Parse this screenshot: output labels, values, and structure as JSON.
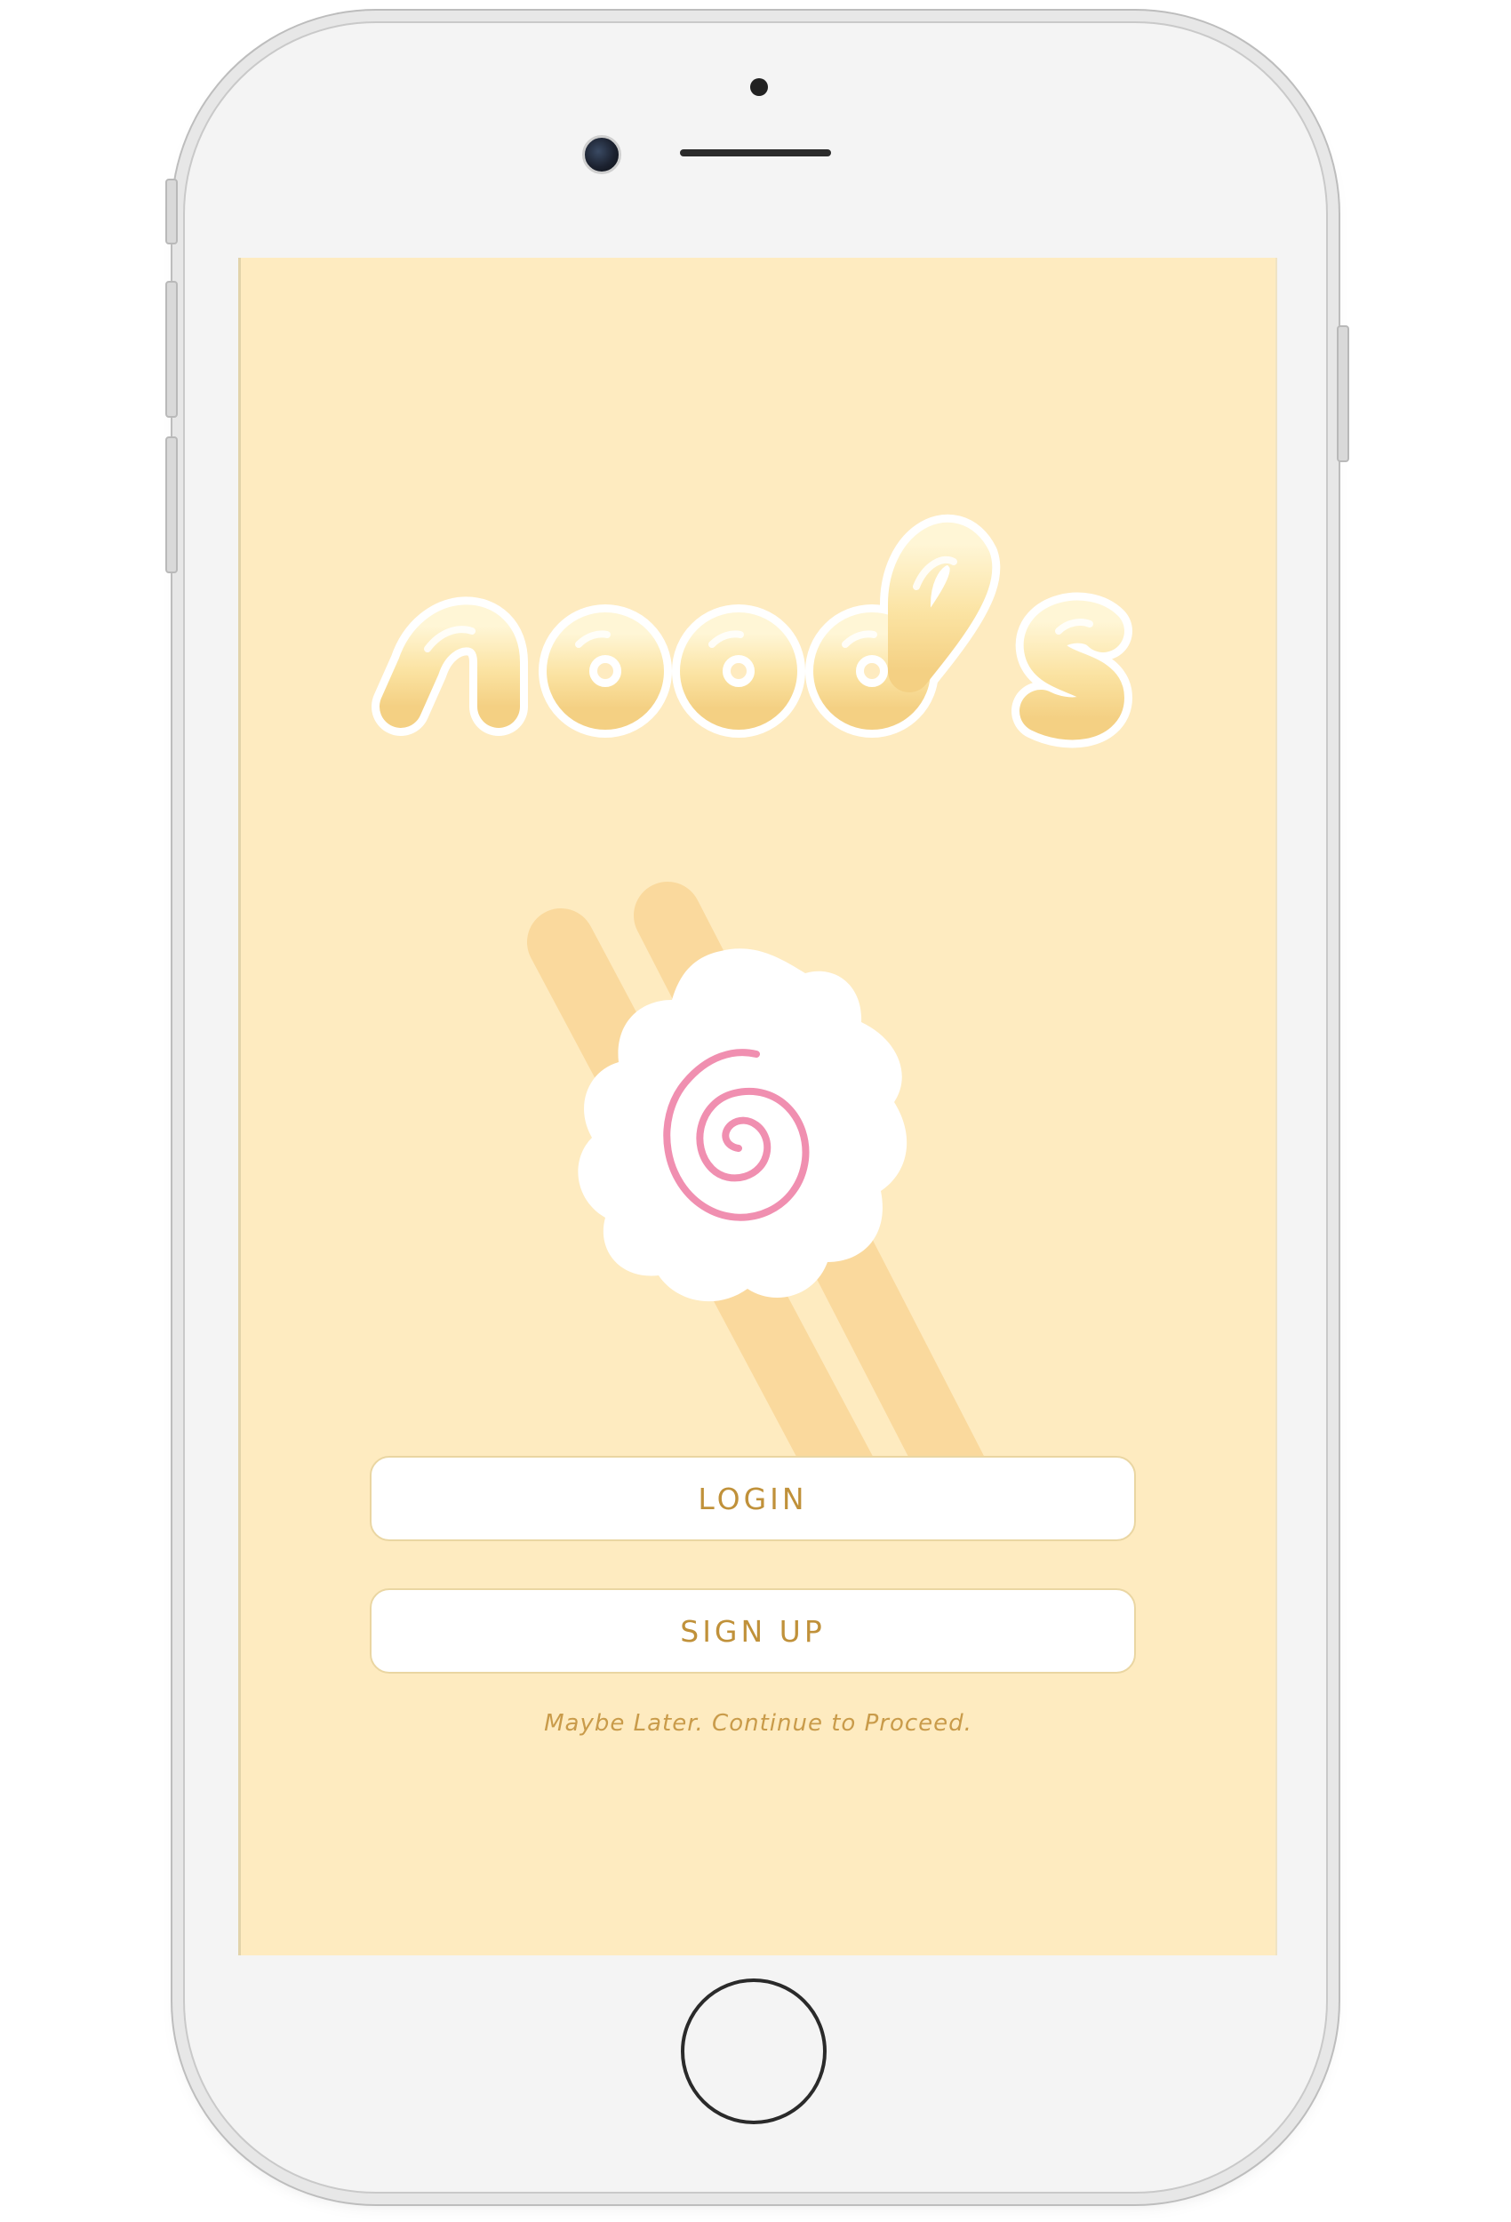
{
  "app": {
    "logo_text": "noods",
    "background_color": "#feebc0",
    "accent_color": "#c0913a",
    "spiral_color": "#f08fb0"
  },
  "illustration": {
    "icons": [
      "chopsticks-icon",
      "narutomaki-icon"
    ]
  },
  "actions": {
    "login_label": "LOGIN",
    "signup_label": "SIGN UP",
    "skip_label": "Maybe Later. Continue to Proceed."
  }
}
